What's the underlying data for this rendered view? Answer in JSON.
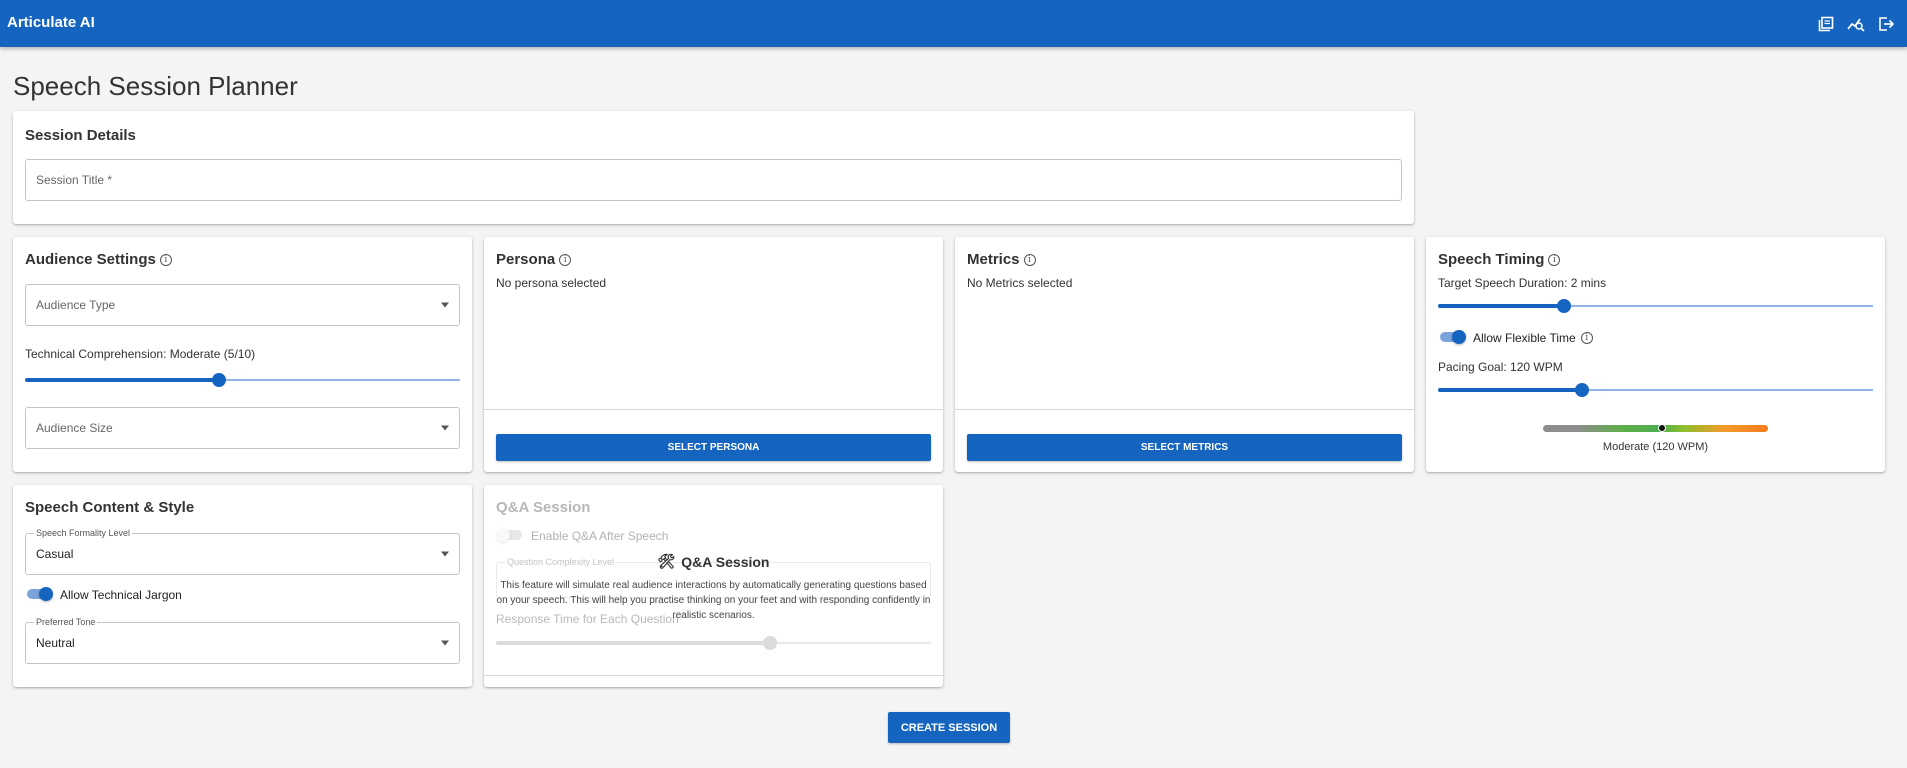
{
  "app": {
    "title": "Articulate AI",
    "header_icons": [
      "library-icon",
      "analytics-icon",
      "logout-icon"
    ]
  },
  "page": {
    "title": "Speech Session Planner"
  },
  "session_details": {
    "title": "Session Details",
    "session_title_placeholder": "Session Title *"
  },
  "audience": {
    "title": "Audience Settings",
    "audience_type_placeholder": "Audience Type",
    "tech_label": "Technical Comprehension: Moderate (5/10)",
    "tech_value": 5,
    "tech_max": 10,
    "audience_size_placeholder": "Audience Size"
  },
  "persona": {
    "title": "Persona",
    "status": "No persona selected",
    "button": "Select Persona"
  },
  "metrics": {
    "title": "Metrics",
    "status": "No Metrics selected",
    "button": "Select Metrics"
  },
  "timing": {
    "title": "Speech Timing",
    "duration_label": "Target Speech Duration: 2 mins",
    "duration_fraction": 0.29,
    "flexible_label": "Allow Flexible Time",
    "flexible_on": true,
    "pacing_label": "Pacing Goal: 120 WPM",
    "pacing_fraction": 0.33,
    "pace_indicator_fraction": 0.53,
    "pace_caption": "Moderate (120 WPM)"
  },
  "content_style": {
    "title": "Speech Content & Style",
    "formality_legend": "Speech Formality Level",
    "formality_value": "Casual",
    "jargon_label": "Allow Technical Jargon",
    "jargon_on": true,
    "tone_legend": "Preferred Tone",
    "tone_value": "Neutral"
  },
  "qa": {
    "title": "Q&A Session",
    "enable_label": "Enable Q&A After Speech",
    "complexity_legend": "Question Complexity Level",
    "response_label": "Response Time for Each Question",
    "response_fraction": 0.63,
    "overlay_title": "Q&A Session",
    "overlay_text": "This feature will simulate real audience interactions by automatically generating questions based on your speech. This will help you practise thinking on your feet and with responding confidently in realistic scenarios."
  },
  "actions": {
    "create": "Create Session"
  },
  "colors": {
    "primary": "#1565c0",
    "background": "#f4f4f4"
  }
}
